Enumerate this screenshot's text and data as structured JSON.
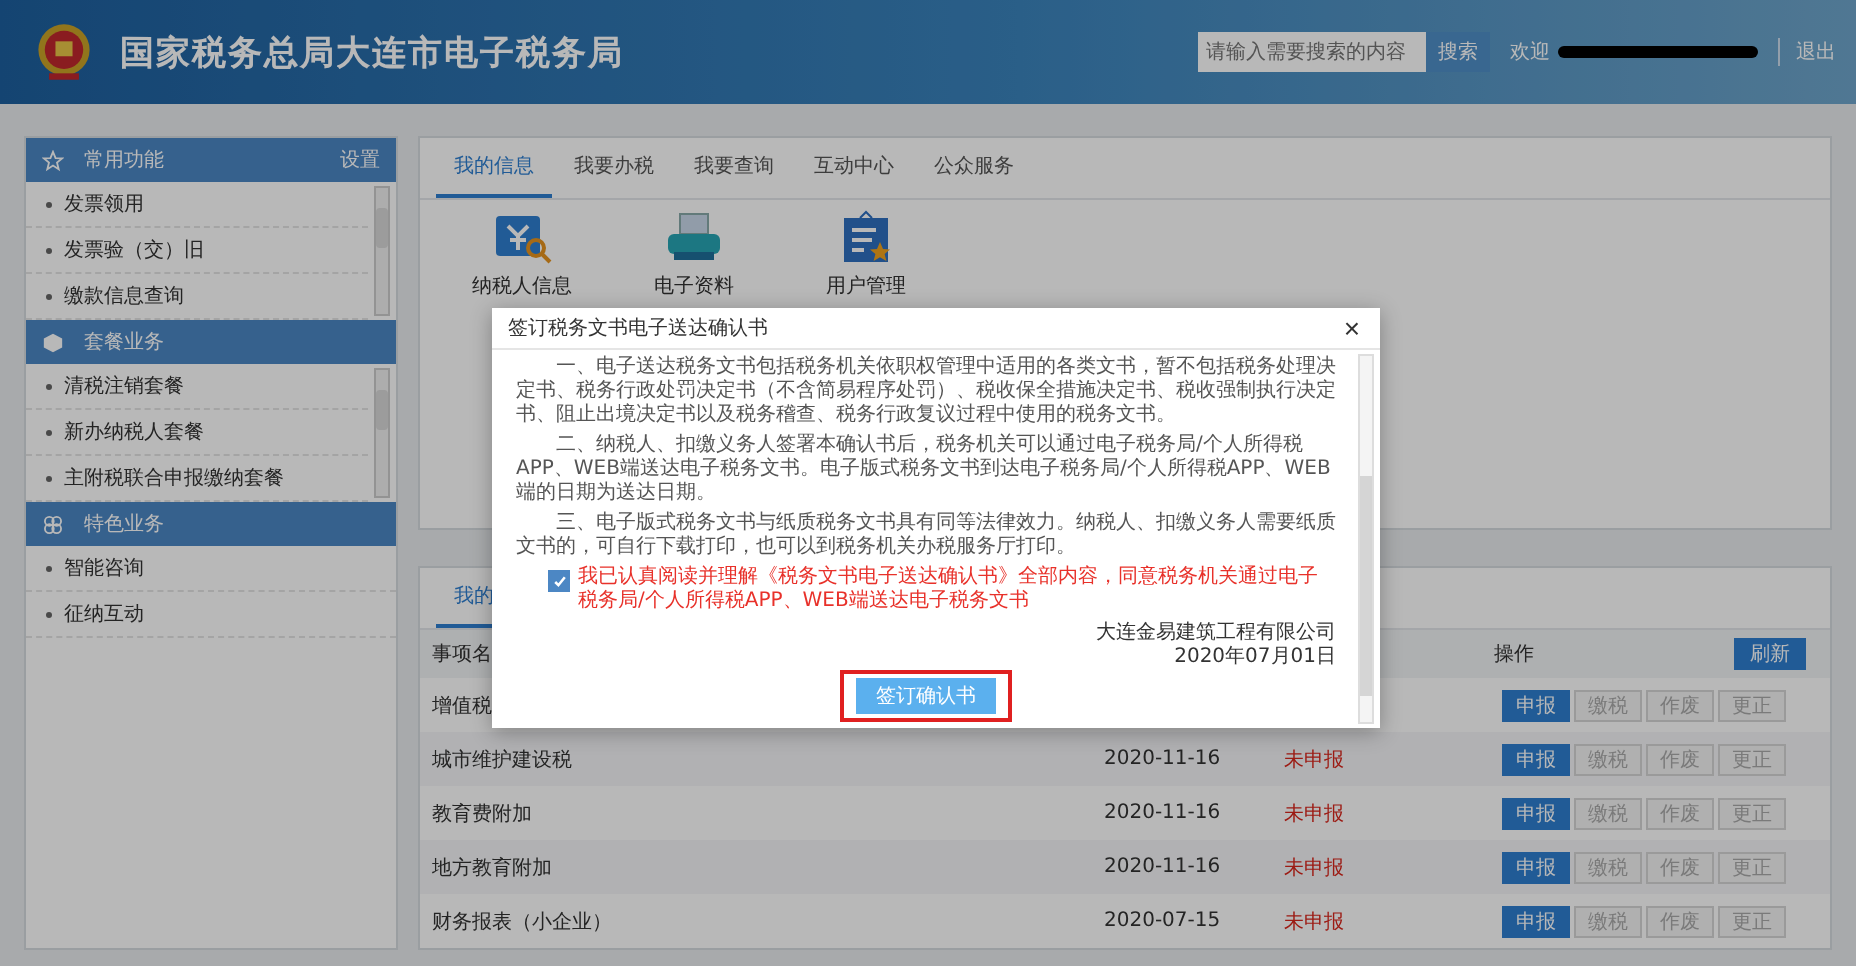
{
  "header": {
    "title": "国家税务总局大连市电子税务局",
    "search": {
      "placeholder": "请输入需要搜索的内容"
    },
    "search_button": "搜索",
    "welcome": "欢迎",
    "logout": "退出"
  },
  "sidebar": {
    "sections": [
      {
        "kind": "star",
        "title": "常用功能",
        "action": "设置",
        "scrollbar": true,
        "items": [
          "发票领用",
          "发票验（交）旧",
          "缴款信息查询"
        ]
      },
      {
        "kind": "cube",
        "title": "套餐业务",
        "scrollbar": true,
        "items": [
          "清税注销套餐",
          "新办纳税人套餐",
          "主附税联合申报缴纳套餐"
        ]
      },
      {
        "kind": "flower",
        "title": "特色业务",
        "scrollbar": false,
        "items": [
          "智能咨询",
          "征纳互动"
        ]
      }
    ]
  },
  "tabs": [
    {
      "label": "我的信息",
      "selected": true
    },
    {
      "label": "我要办税",
      "selected": false
    },
    {
      "label": "我要查询",
      "selected": false
    },
    {
      "label": "互动中心",
      "selected": false
    },
    {
      "label": "公众服务",
      "selected": false
    }
  ],
  "shortcuts": [
    {
      "kind": "taxpayer",
      "label": "纳税人信息"
    },
    {
      "kind": "printer",
      "label": "电子资料"
    },
    {
      "kind": "user",
      "label": "用户管理"
    }
  ],
  "todo": {
    "tabs": [
      {
        "label": "我的",
        "selected": true
      }
    ],
    "columns": [
      "事项名",
      "操作"
    ],
    "refresh_button": "刷新",
    "rows": [
      {
        "name": "增值税",
        "actions": [
          {
            "label": "申报",
            "disabled": false
          },
          {
            "label": "缴税",
            "disabled": true
          },
          {
            "label": "作废",
            "disabled": true
          },
          {
            "label": "更正",
            "disabled": true
          }
        ]
      },
      {
        "name": "城市维护建设税",
        "date": "2020-11-16",
        "status": "未申报",
        "actions": [
          {
            "label": "申报",
            "disabled": false
          },
          {
            "label": "缴税",
            "disabled": true
          },
          {
            "label": "作废",
            "disabled": true
          },
          {
            "label": "更正",
            "disabled": true
          }
        ]
      },
      {
        "name": "教育费附加",
        "date": "2020-11-16",
        "status": "未申报",
        "actions": [
          {
            "label": "申报",
            "disabled": false
          },
          {
            "label": "缴税",
            "disabled": true
          },
          {
            "label": "作废",
            "disabled": true
          },
          {
            "label": "更正",
            "disabled": true
          }
        ]
      },
      {
        "name": "地方教育附加",
        "date": "2020-11-16",
        "status": "未申报",
        "actions": [
          {
            "label": "申报",
            "disabled": false
          },
          {
            "label": "缴税",
            "disabled": true
          },
          {
            "label": "作废",
            "disabled": true
          },
          {
            "label": "更正",
            "disabled": true
          }
        ]
      },
      {
        "name": "财务报表（小企业）",
        "date": "2020-07-15",
        "status": "未申报",
        "actions": [
          {
            "label": "申报",
            "disabled": false
          },
          {
            "label": "缴税",
            "disabled": true
          },
          {
            "label": "作废",
            "disabled": true
          },
          {
            "label": "更正",
            "disabled": true
          }
        ]
      }
    ]
  },
  "modal": {
    "title": "签订税务文书电子送达确认书",
    "close": "×",
    "paragraphs": [
      "一、电子送达税务文书包括税务机关依职权管理中适用的各类文书，暂不包括税务处理决定书、税务行政处罚决定书（不含简易程序处罚）、税收保全措施决定书、税收强制执行决定书、阻止出境决定书以及税务稽查、税务行政复议过程中使用的税务文书。",
      "二、纳税人、扣缴义务人签署本确认书后，税务机关可以通过电子税务局/个人所得税APP、WEB端送达电子税务文书。电子版式税务文书到达电子税务局/个人所得税APP、WEB端的日期为送达日期。",
      "三、电子版式税务文书与纸质税务文书具有同等法律效力。纳税人、扣缴义务人需要纸质文书的，可自行下载打印，也可以到税务机关办税服务厅打印。"
    ],
    "agreement": {
      "checked": true,
      "text": "我已认真阅读并理解《税务文书电子送达确认书》全部内容，同意税务机关通过电子税务局/个人所得税APP、WEB端送达电子税务文书"
    },
    "company": "大连金易建筑工程有限公司",
    "date": "2020年07月01日",
    "confirm_button": "签订确认书",
    "highlighted": true
  }
}
